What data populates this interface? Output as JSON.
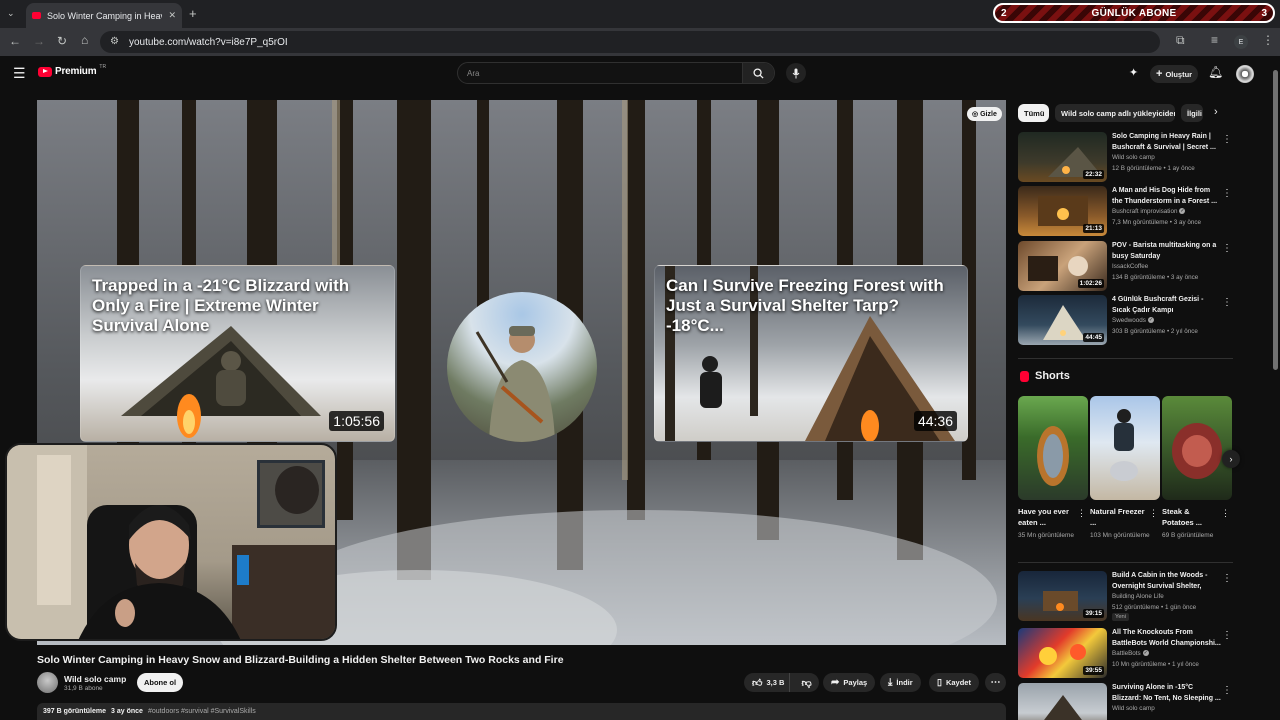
{
  "browser": {
    "tab_title": "Solo Winter Camping in Heavy",
    "url": "youtube.com/watch?v=i8e7P_q5rOI"
  },
  "counter_widget": {
    "left_value": "2",
    "label": "GÜNLÜK ABONE",
    "right_value": "3"
  },
  "yt_header": {
    "brand": "Premium",
    "country": "TR",
    "search_placeholder": "Ara",
    "create_label": "Oluştur"
  },
  "player": {
    "hide_label": "Gizle",
    "endcards": [
      {
        "title": "Trapped in a -21°C Blizzard with Only a Fire | Extreme Winter Survival Alone",
        "duration": "1:05:56"
      },
      {
        "title": "Can I Survive Freezing Forest with Just a Survival Shelter Tarp? -18°C...",
        "duration": "44:36"
      }
    ]
  },
  "video": {
    "title": "Solo Winter Camping in Heavy Snow and Blizzard-Building a Hidden Shelter Between Two Rocks and Fire",
    "channel": "Wild solo camp",
    "subscribers": "31,9 B abone",
    "subscribe_label": "Abone ol",
    "likes": "3,3 B",
    "share_label": "Paylaş",
    "download_label": "İndir",
    "save_label": "Kaydet",
    "views": "397 B görüntüleme",
    "date": "3 ay önce",
    "tags": "#outdoors #survival #SurvivalSkills"
  },
  "sidebar": {
    "chips": [
      "Tümü",
      "Wild solo camp adlı yükleyiciden",
      "İlgili"
    ],
    "videos_top": [
      {
        "title": "Solo Camping in Heavy Rain | Bushcraft & Survival | Secret ...",
        "channel": "Wild solo camp",
        "meta": "12 B görüntüleme • 1 ay önce",
        "duration": "22:32",
        "verified": false
      },
      {
        "title": "A Man and His Dog Hide from the Thunderstorm in a Forest ...",
        "channel": "Bushcraft improvisation",
        "meta": "7,3 Mn görüntüleme • 3 ay önce",
        "duration": "21:13",
        "verified": true
      },
      {
        "title": "POV - Barista multitasking on a busy Saturday",
        "channel": "IssackCoffee",
        "meta": "134 B görüntüleme • 3 ay önce",
        "duration": "1:02:26",
        "verified": false
      },
      {
        "title": "4 Günlük Bushcraft Gezisi - Sıcak Çadır Kampı",
        "channel": "Swedwoods",
        "meta": "303 B görüntüleme • 2 yıl önce",
        "duration": "44:45",
        "verified": true
      }
    ],
    "shorts_heading": "Shorts",
    "shorts": [
      {
        "title": "Have you ever eaten ...",
        "views": "35 Mn görüntüleme"
      },
      {
        "title": "Natural Freezer ...",
        "views": "103 Mn görüntüleme"
      },
      {
        "title": "Steak & Potatoes ...",
        "views": "69 B görüntüleme"
      }
    ],
    "videos_bottom": [
      {
        "title": "Build A Cabin in the Woods - Overnight Survival Shelter, Buil...",
        "channel": "Building Alone Life",
        "meta": "512 görüntüleme • 1 gün önce",
        "duration": "39:15",
        "badge": "Yeni",
        "verified": false
      },
      {
        "title": "All The Knockouts From BattleBots World Championshi...",
        "channel": "BattleBots",
        "meta": "10 Mn görüntüleme • 1 yıl önce",
        "duration": "39:55",
        "verified": true
      },
      {
        "title": "Surviving Alone in -15°C Blizzard: No Tent, No Sleeping ...",
        "channel": "Wild solo camp",
        "meta": "",
        "duration": "",
        "verified": false
      }
    ]
  },
  "icons": {
    "menu": "hamburger-icon",
    "search": "search-icon",
    "mic": "microphone-icon",
    "bell": "bell-icon",
    "like": "thumbs-up-icon",
    "dislike": "thumbs-down-icon"
  },
  "colors": {
    "background": "#0f0f0f",
    "youtube_red": "#ff0033",
    "counter_red": "#7a1010"
  }
}
